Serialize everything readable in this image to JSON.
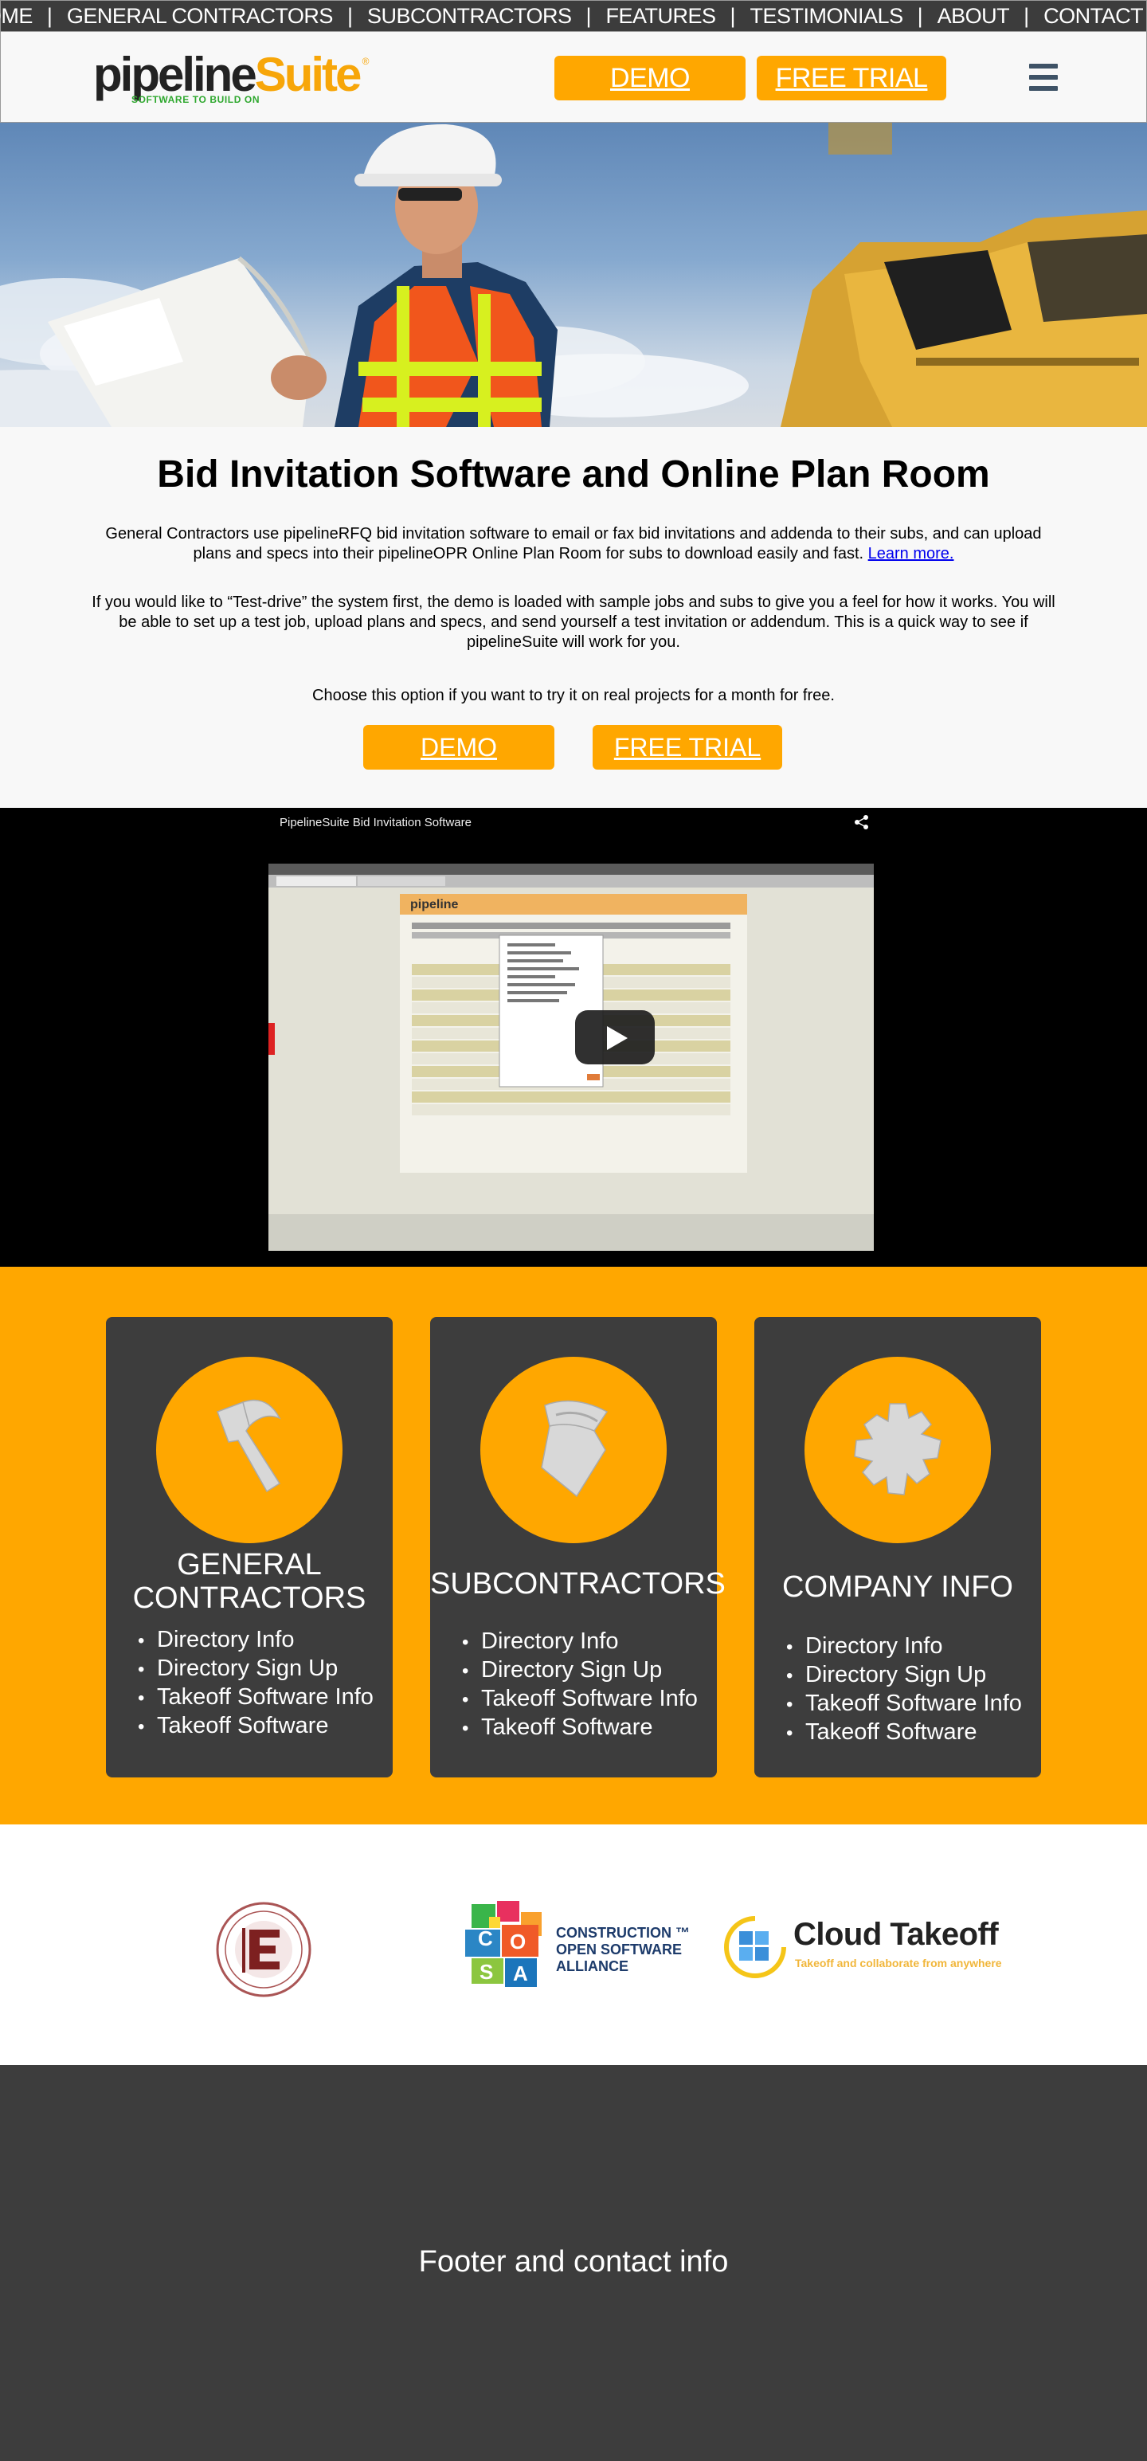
{
  "topnav": {
    "items": [
      "HOME",
      "GENERAL CONTRACTORS",
      "SUBCONTRACTORS",
      "FEATURES",
      "TESTIMONIALS",
      "ABOUT",
      "CONTACT US"
    ]
  },
  "header": {
    "logo_word1": "pipeline",
    "logo_word2": "Suite",
    "logo_tagline": "SOFTWARE TO BUILD ON",
    "demo_label": "DEMO",
    "trial_label": "FREE TRIAL"
  },
  "intro": {
    "title": "Bid Invitation Software and Online Plan Room",
    "para1": "General Contractors use pipelineRFQ bid invitation software to email or fax bid invitations and addenda to their subs, and can upload plans and specs into their pipelineOPR Online Plan Room for subs to download easily and fast.",
    "learn_more": "Learn more.",
    "para2": "If you would like to “Test-drive” the system first, the demo is loaded with sample jobs and subs to give you a feel for how it works. You will be able to set up a test job, upload plans and specs, and send yourself a test invitation or addendum. This is a quick way to see if pipelineSuite will work for you.",
    "para3": "Choose this option if you want to try it on real projects for a month for free.",
    "demo_label": "DEMO",
    "trial_label": "FREE TRIAL"
  },
  "video": {
    "title": "PipelineSuite Bid Invitation Software",
    "screen_brand": "pipeline"
  },
  "cards": [
    {
      "title_line1": "GENERAL",
      "title_line2": "CONTRACTORS",
      "icon": "hammer-icon",
      "items": [
        "Directory Info",
        "Directory Sign Up",
        "Takeoff Software Info",
        "Takeoff Software"
      ]
    },
    {
      "title_line1": "SUBCONTRACTORS",
      "title_line2": "",
      "icon": "trowel-icon",
      "items": [
        "Directory Info",
        "Directory Sign Up",
        "Takeoff Software Info",
        "Takeoff Software"
      ]
    },
    {
      "title_line1": "COMPANY INFO",
      "title_line2": "",
      "icon": "gear-icon",
      "items": [
        "Directory Info",
        "Directory Sign Up",
        "Takeoff Software Info",
        "Takeoff Software"
      ]
    }
  ],
  "partners": {
    "cosa_letters": [
      "C",
      "O",
      "S",
      "A"
    ],
    "cosa_text": [
      "CONSTRUCTION ™",
      "OPEN SOFTWARE",
      "ALLIANCE"
    ],
    "cloud_title": "Cloud Takeoff",
    "cloud_tagline": "Takeoff and collaborate from anywhere"
  },
  "footer": {
    "text": "Footer and contact info"
  },
  "colors": {
    "accent": "#ffa700",
    "dark": "#3d3d3d",
    "nav": "#3c3c3c",
    "logo_green": "#2fa82f",
    "hamburger": "#3e5266"
  }
}
